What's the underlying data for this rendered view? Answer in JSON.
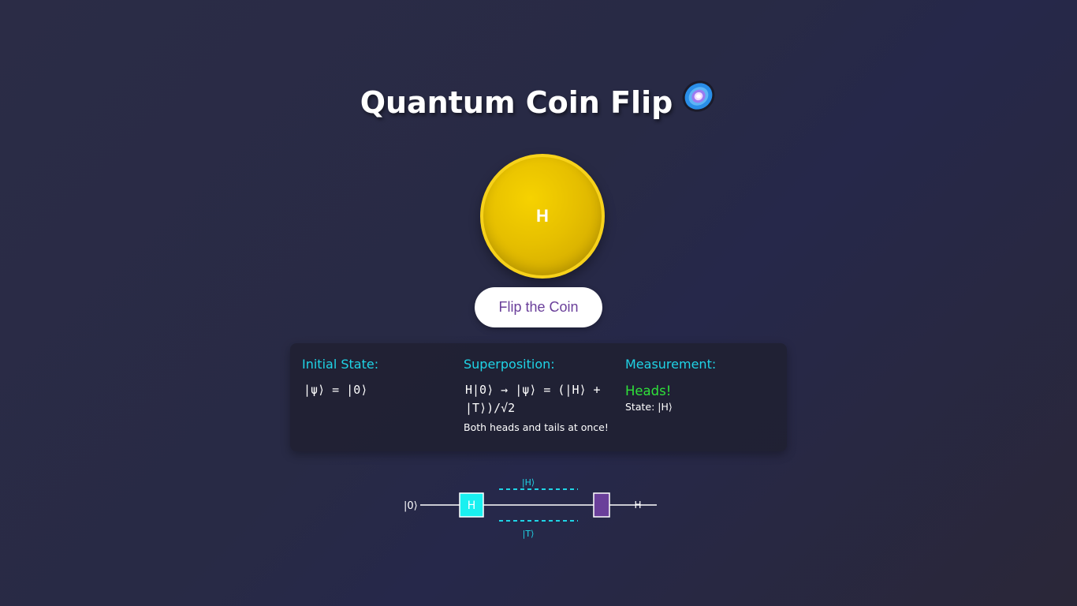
{
  "title": "Quantum Coin Flip",
  "title_icon": "galaxy-emoji-icon",
  "coin": {
    "face": "H",
    "color": "#e6bf00",
    "border_color": "#f7d21a"
  },
  "flip_button": {
    "label": "Flip the Coin"
  },
  "panel": {
    "initial": {
      "heading": "Initial State:",
      "equation": "|ψ⟩ = |0⟩"
    },
    "superposition": {
      "heading": "Superposition:",
      "equation_line1": "H|0⟩ → |ψ⟩ = (|H⟩ +",
      "equation_line2": "|T⟩)/√2",
      "note": "Both heads and tails at once!"
    },
    "measurement": {
      "heading": "Measurement:",
      "result": "Heads!",
      "state": "State: |H⟩"
    }
  },
  "circuit": {
    "input_label": "|0⟩",
    "gate_label": "H",
    "upper_branch": "|H⟩",
    "lower_branch": "|T⟩",
    "output_label": "H"
  },
  "colors": {
    "accent_cyan": "#1fd4e6",
    "result_green": "#2fe23a",
    "button_text": "#6a3f9a",
    "measure_gate": "#6a3f9a"
  }
}
